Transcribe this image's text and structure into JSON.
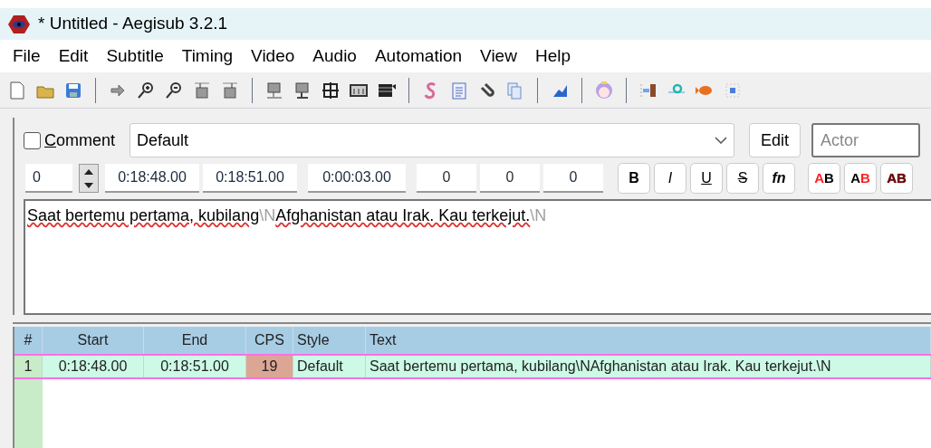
{
  "window": {
    "title": "* Untitled - Aegisub 3.2.1"
  },
  "menu": [
    "File",
    "Edit",
    "Subtitle",
    "Timing",
    "Video",
    "Audio",
    "Automation",
    "View",
    "Help"
  ],
  "editor": {
    "comment": {
      "label": "Comment",
      "checked": false
    },
    "style": "Default",
    "edit_button": "Edit",
    "actor": {
      "placeholder": "Actor"
    },
    "layer": "0",
    "start": "0:18:48.00",
    "end": "0:18:51.00",
    "duration": "0:00:03.00",
    "margins": [
      "0",
      "0",
      "0"
    ],
    "format_buttons": [
      {
        "label": "B",
        "kind": "bold"
      },
      {
        "label": "I",
        "kind": "italic"
      },
      {
        "label": "U",
        "kind": "underline"
      },
      {
        "label": "S",
        "kind": "strike"
      },
      {
        "label": "fn",
        "kind": "font"
      }
    ],
    "color_buttons": [
      {
        "label": "AB",
        "kind": "primary"
      },
      {
        "label": "AB",
        "kind": "secondary"
      },
      {
        "label": "AB",
        "kind": "outline"
      }
    ],
    "text": [
      {
        "kind": "text",
        "text": "Saat bertemu pertama, kubilang"
      },
      {
        "kind": "tag",
        "text": "\\N"
      },
      {
        "kind": "text",
        "text": "Afghanistan atau Irak. Kau terkejut."
      },
      {
        "kind": "tag",
        "text": "\\N"
      }
    ]
  },
  "grid": {
    "columns": [
      "#",
      "Start",
      "End",
      "CPS",
      "Style",
      "Text"
    ],
    "rows": [
      {
        "cells": [
          "1",
          "0:18:48.00",
          "0:18:51.00",
          "19",
          "Default",
          "Saat bertemu pertama, kubilang\\NAfghanistan atau Irak. Kau terkejut.\\N"
        ],
        "selected": true
      }
    ]
  }
}
